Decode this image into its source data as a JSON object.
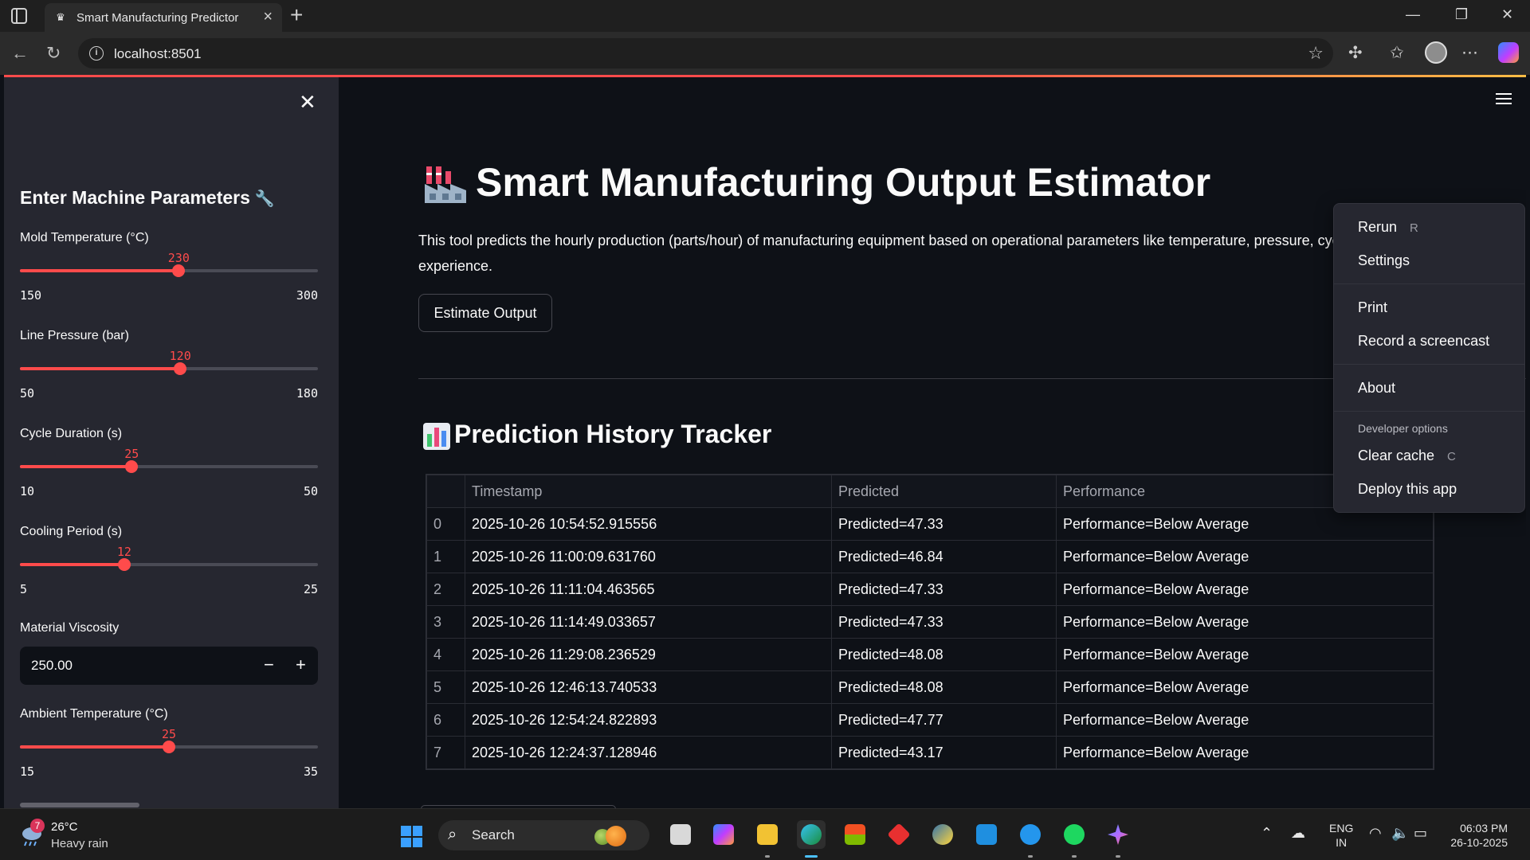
{
  "browser": {
    "tab_title": "Smart Manufacturing Predictor",
    "url": "localhost:8501"
  },
  "sidebar": {
    "header": "Enter Machine Parameters",
    "sliders": [
      {
        "label": "Mold Temperature (°C)",
        "value": "230",
        "min": "150",
        "max": "300",
        "fraction": 0.533
      },
      {
        "label": "Line Pressure (bar)",
        "value": "120",
        "min": "50",
        "max": "180",
        "fraction": 0.538
      },
      {
        "label": "Cycle Duration (s)",
        "value": "25",
        "min": "10",
        "max": "50",
        "fraction": 0.375
      },
      {
        "label": "Cooling Period (s)",
        "value": "12",
        "min": "5",
        "max": "25",
        "fraction": 0.35
      },
      {
        "label": "Ambient Temperature (°C)",
        "value": "25",
        "min": "15",
        "max": "35",
        "fraction": 0.5
      }
    ],
    "number_input": {
      "label": "Material Viscosity",
      "value": "250.00",
      "minus": "−",
      "plus": "+"
    }
  },
  "main": {
    "title": "Smart Manufacturing Output Estimator",
    "description": "This tool predicts the hourly production (parts/hour) of manufacturing equipment based on operational parameters like temperature, pressure, cycle time, and operator experience.",
    "estimate_button": "Estimate Output",
    "history_title": "Prediction History Tracker",
    "table": {
      "columns": [
        "",
        "Timestamp",
        "Predicted",
        "Performance"
      ],
      "rows": [
        [
          "0",
          "2025-10-26 10:54:52.915556",
          "Predicted=47.33",
          "Performance=Below Average"
        ],
        [
          "1",
          "2025-10-26 11:00:09.631760",
          "Predicted=46.84",
          "Performance=Below Average"
        ],
        [
          "2",
          "2025-10-26 11:11:04.463565",
          "Predicted=47.33",
          "Performance=Below Average"
        ],
        [
          "3",
          "2025-10-26 11:14:49.033657",
          "Predicted=47.33",
          "Performance=Below Average"
        ],
        [
          "4",
          "2025-10-26 11:29:08.236529",
          "Predicted=48.08",
          "Performance=Below Average"
        ],
        [
          "5",
          "2025-10-26 12:46:13.740533",
          "Predicted=48.08",
          "Performance=Below Average"
        ],
        [
          "6",
          "2025-10-26 12:54:24.822893",
          "Predicted=47.77",
          "Performance=Below Average"
        ],
        [
          "7",
          "2025-10-26 12:24:37.128946",
          "Predicted=43.17",
          "Performance=Below Average"
        ]
      ]
    }
  },
  "menu": {
    "rerun": "Rerun",
    "rerun_key": "R",
    "settings": "Settings",
    "print": "Print",
    "record": "Record a screencast",
    "about": "About",
    "dev_label": "Developer options",
    "clear_cache": "Clear cache",
    "clear_cache_key": "C",
    "deploy": "Deploy this app"
  },
  "taskbar": {
    "weather_temp": "26°C",
    "weather_desc": "Heavy rain",
    "weather_badge": "7",
    "search": "Search",
    "lang_top": "ENG",
    "lang_bottom": "IN",
    "time": "06:03 PM",
    "date": "26-10-2025"
  },
  "colors": {
    "accent": "#ff4b4b",
    "bg": "#0e1117",
    "sidebar": "#262730"
  }
}
